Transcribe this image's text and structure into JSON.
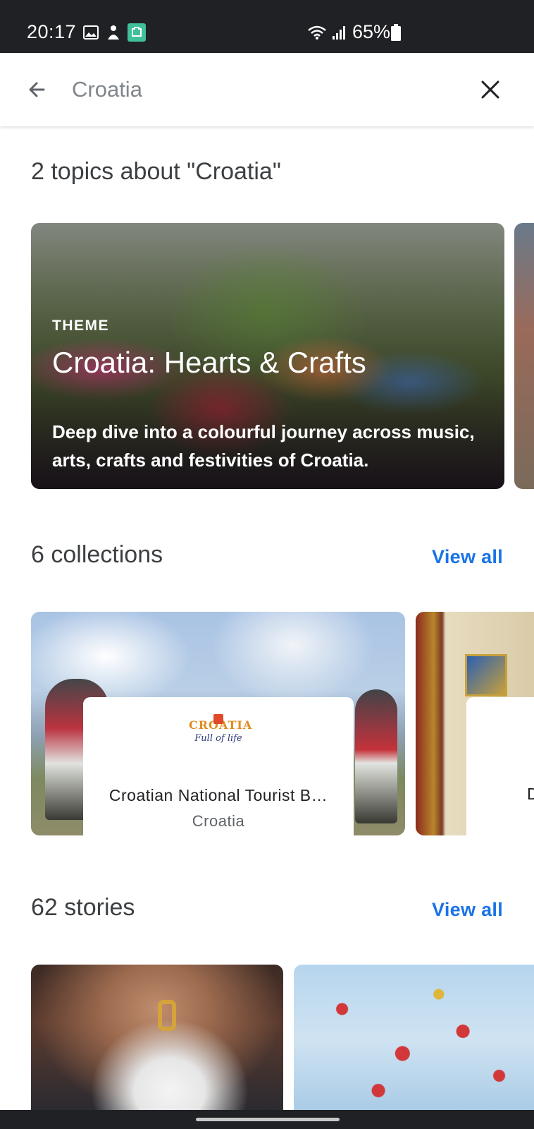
{
  "status_bar": {
    "time": "20:17",
    "battery": "65%",
    "icons": [
      "gallery-icon",
      "notification-icon",
      "app-icon",
      "wifi-icon",
      "signal-icon",
      "battery-icon"
    ]
  },
  "search": {
    "query": "Croatia",
    "back_icon": "arrow-back-icon",
    "close_icon": "close-icon"
  },
  "topics": {
    "heading": "2 topics about \"Croatia\"",
    "items": [
      {
        "eyebrow": "THEME",
        "title": "Croatia: Hearts & Crafts",
        "description": "Deep dive into a colourful journey across music, arts, crafts and festivities of Croatia."
      }
    ]
  },
  "collections": {
    "heading": "6 collections",
    "view_all": "View all",
    "items": [
      {
        "logo_text": "CROATIA",
        "logo_sub": "Full of life",
        "name": "Croatian National Tourist B…",
        "subtitle": "Croatia"
      },
      {
        "name_peek": "D"
      }
    ]
  },
  "stories": {
    "heading": "62 stories",
    "view_all": "View all"
  },
  "colors": {
    "accent": "#1a73e8",
    "status_bar": "#1f2125",
    "text_primary": "#202124",
    "text_secondary": "#5f6368"
  }
}
